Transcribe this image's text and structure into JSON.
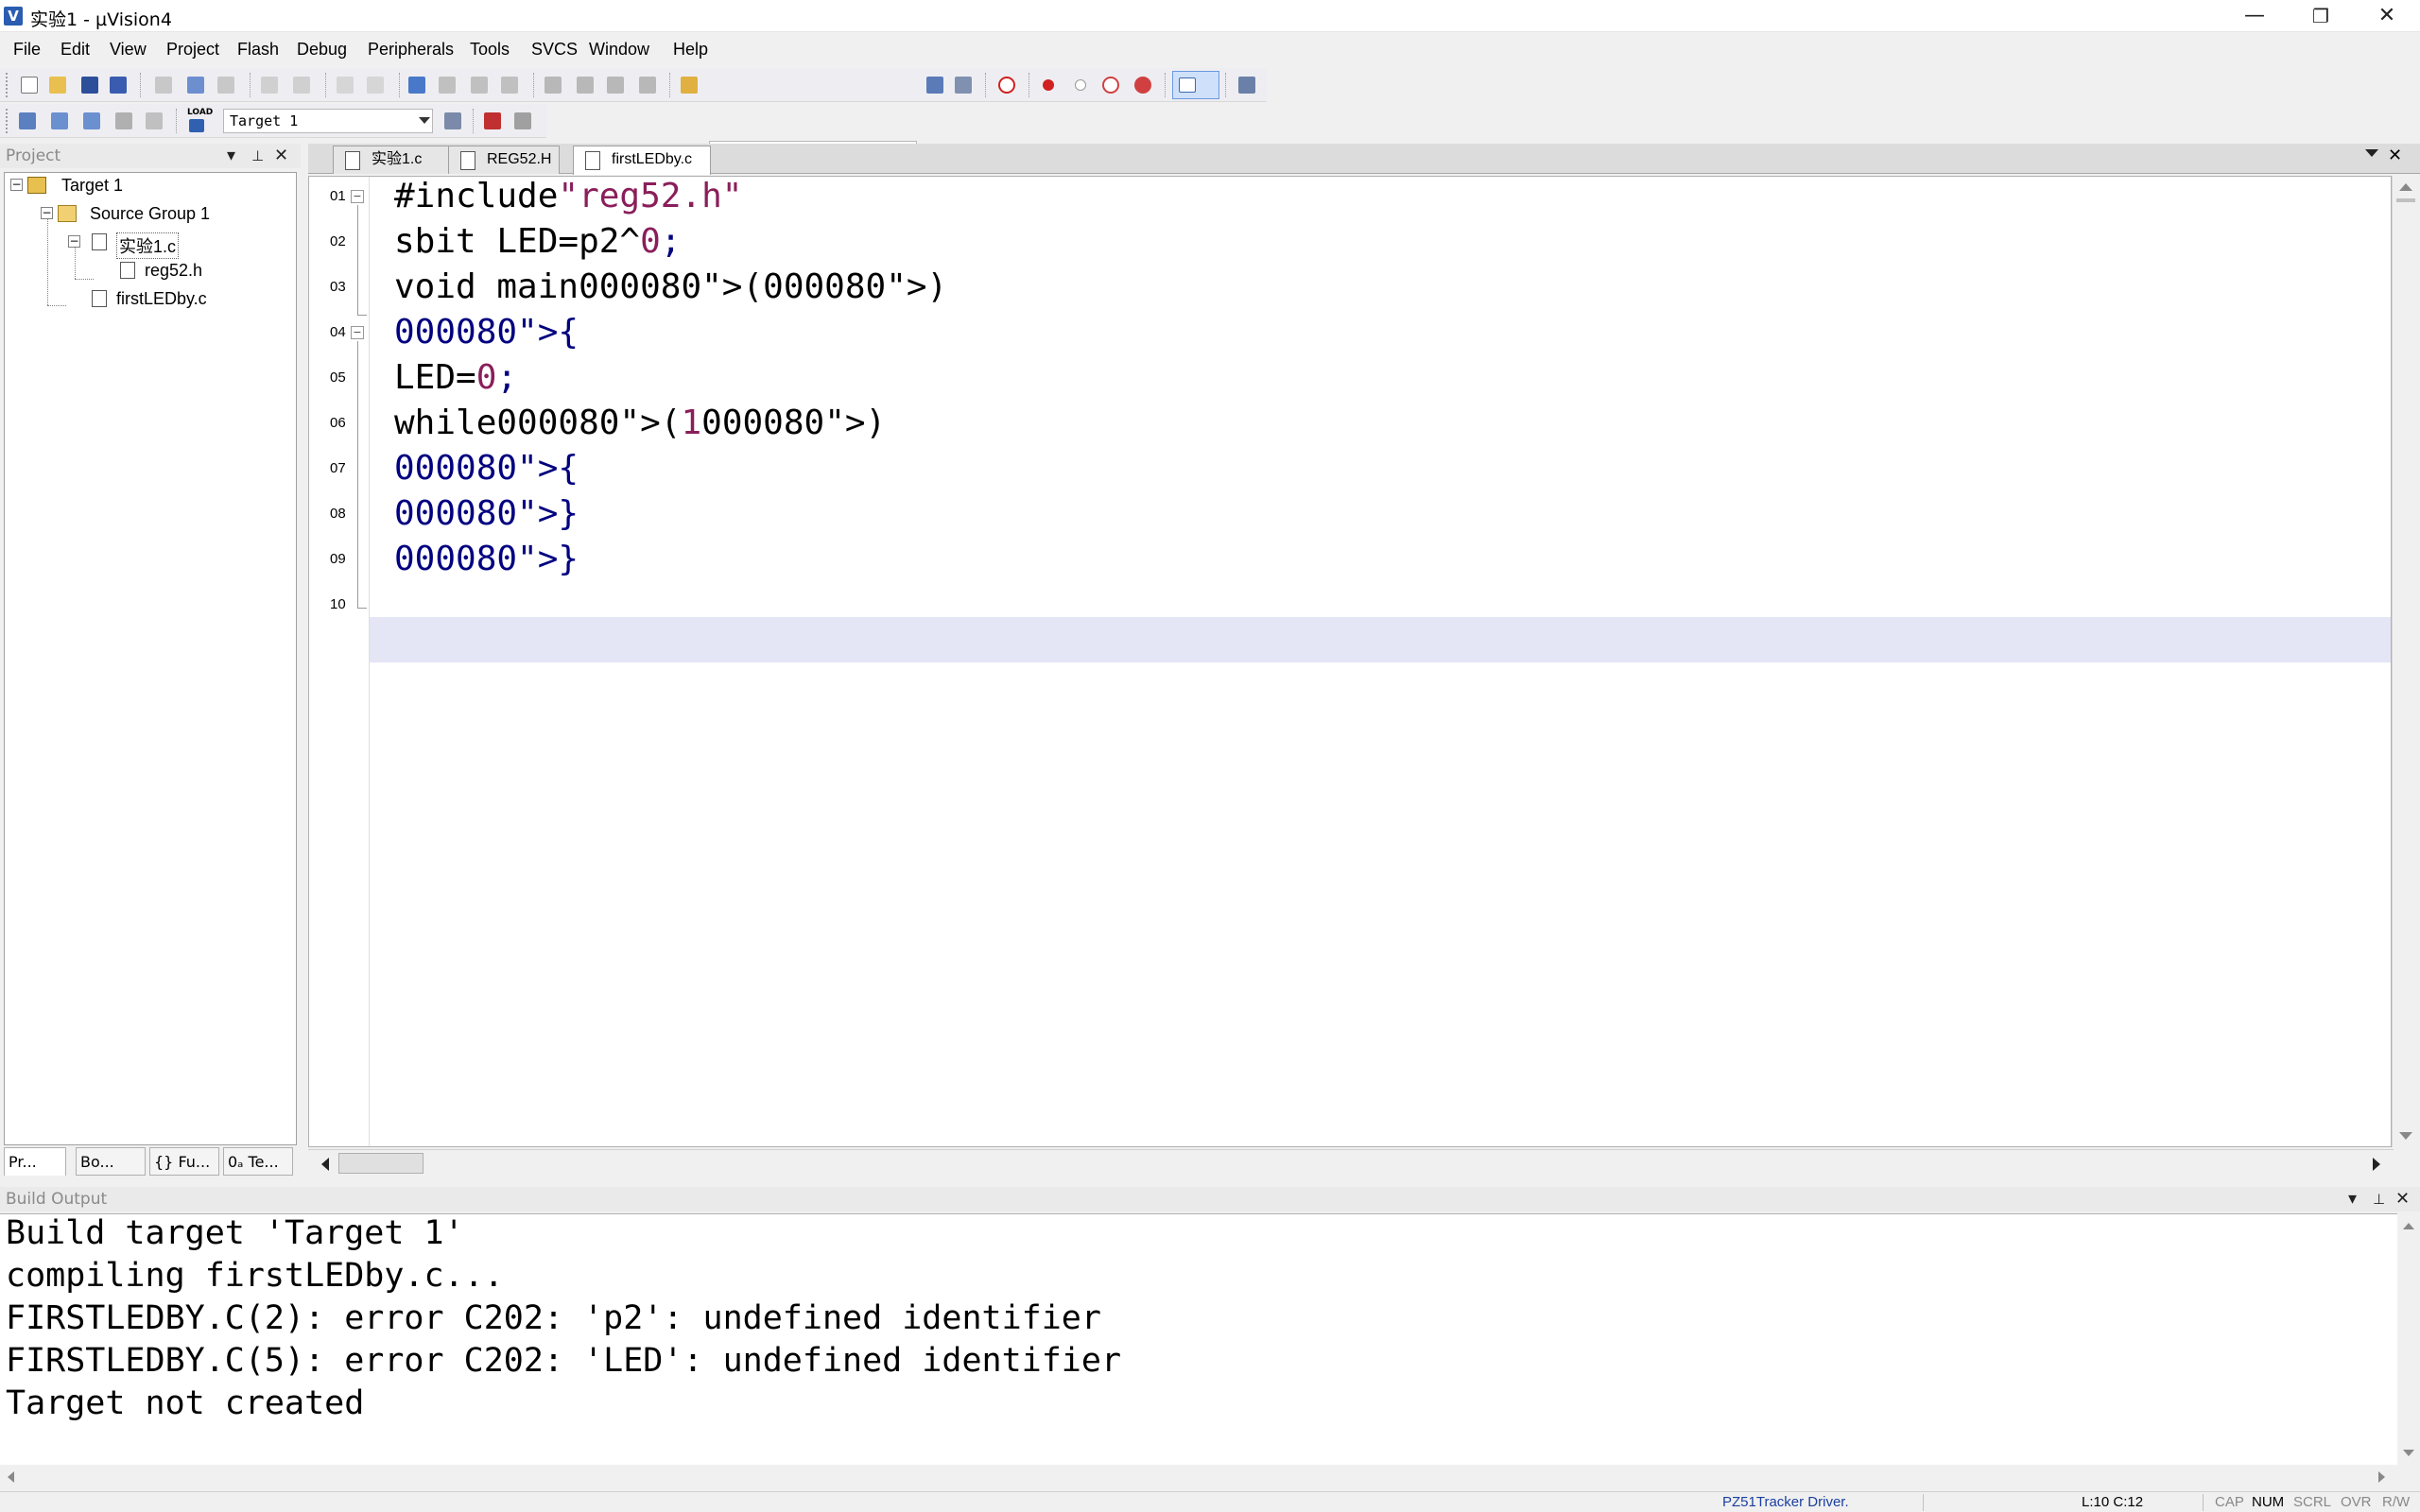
{
  "window": {
    "title": "实验1  - µVision4",
    "minimize": "—",
    "maximize": "❐",
    "close": "✕",
    "app_icon": "V"
  },
  "menu": [
    {
      "label": "File",
      "accel": "F"
    },
    {
      "label": "Edit",
      "accel": "E"
    },
    {
      "label": "View",
      "accel": "V"
    },
    {
      "label": "Project",
      "accel": "P"
    },
    {
      "label": "Flash",
      "accel": "a"
    },
    {
      "label": "Debug",
      "accel": "D"
    },
    {
      "label": "Peripherals",
      "accel": "P"
    },
    {
      "label": "Tools",
      "accel": "T"
    },
    {
      "label": "SVCS",
      "accel": "S"
    },
    {
      "label": "Window",
      "accel": "W"
    },
    {
      "label": "Help",
      "accel": "H"
    }
  ],
  "toolbar": {
    "search_combo_value": "",
    "target_combo_value": "Target 1",
    "load_label": "LOAD"
  },
  "project": {
    "header": "Project",
    "tree": {
      "root": "Target 1",
      "group": "Source Group 1",
      "file1": "实验1.c",
      "include1": "reg52.h",
      "file2": "firstLEDby.c"
    },
    "tabs": [
      "Pr...",
      "Bo...",
      "{} Fu...",
      "0ₐ Te..."
    ]
  },
  "editor": {
    "tabs": [
      "实验1.c",
      "REG52.H",
      "firstLEDby.c"
    ],
    "active_tab": "firstLEDby.c",
    "line_numbers": [
      "01",
      "02",
      "03",
      "04",
      "05",
      "06",
      "07",
      "08",
      "09",
      "10"
    ],
    "lines": [
      "#include\"reg52.h\"",
      "sbit LED=p2^0;",
      "void main()",
      "{",
      "LED=0;",
      "while(1)",
      "{",
      "}",
      "}",
      ""
    ],
    "current_line_color": "#e4e6f6"
  },
  "build": {
    "header": "Build Output",
    "lines": [
      "Build target 'Target 1'",
      "compiling firstLEDby.c...",
      "FIRSTLEDBY.C(2): error C202: 'p2': undefined identifier",
      "FIRSTLEDBY.C(5): error C202: 'LED': undefined identifier",
      "Target not created"
    ]
  },
  "status": {
    "driver": "PZ51Tracker Driver.",
    "position": "L:10 C:12",
    "cap": "CAP",
    "num": "NUM",
    "scrl": "SCRL",
    "ovr": "OVR",
    "rw": "R/W"
  },
  "colors": {
    "accent": "#2a5db0",
    "string_color": "#8a1e5a",
    "bracket_color": "#000080",
    "driver_text": "#1a3fa0"
  }
}
